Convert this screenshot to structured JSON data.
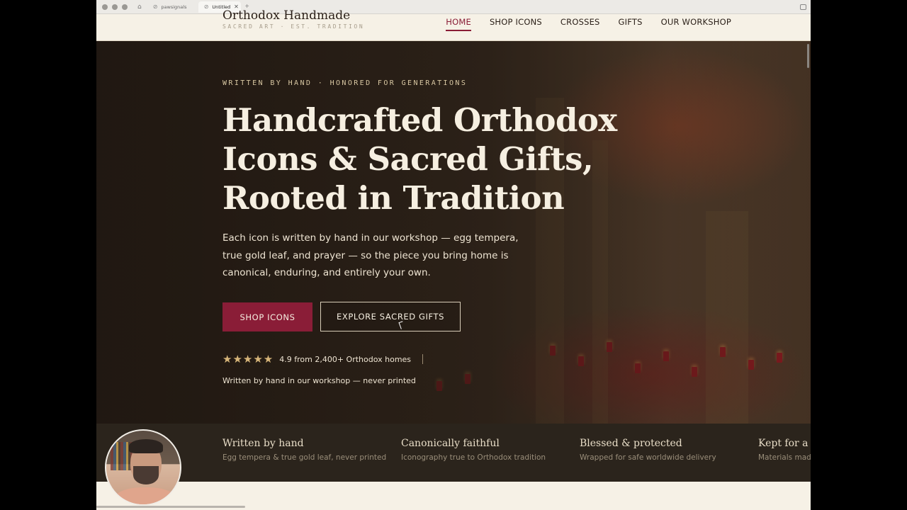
{
  "browser": {
    "tabs": [
      {
        "label": "pawsignals",
        "active": false
      },
      {
        "label": "Untitled",
        "active": true
      }
    ],
    "new_tab": "+"
  },
  "site": {
    "brand": "Orthodox Handmade",
    "tagline": "SACRED ART · EST. TRADITION",
    "nav": [
      {
        "label": "HOME",
        "active": true
      },
      {
        "label": "SHOP ICONS",
        "active": false
      },
      {
        "label": "CROSSES",
        "active": false
      },
      {
        "label": "GIFTS",
        "active": false
      },
      {
        "label": "OUR WORKSHOP",
        "active": false
      }
    ]
  },
  "hero": {
    "eyebrow": "WRITTEN BY HAND · HONORED FOR GENERATIONS",
    "title_lines": [
      "Handcrafted Orthodox",
      "Icons & Sacred Gifts,",
      "Rooted in Tradition"
    ],
    "body": "Each icon is written by hand in our workshop — egg tempera, true gold leaf, and prayer — so the piece you bring home is canonical, enduring, and entirely your own.",
    "primary_cta": "SHOP ICONS",
    "secondary_cta": "EXPLORE SACRED GIFTS",
    "stars": "★★★★★",
    "rating_value": 4.9,
    "rating_text": "4.9 from 2,400+ Orthodox homes",
    "note": "Written by hand in our workshop — never printed"
  },
  "features": [
    {
      "title": "Written by hand",
      "desc": "Egg tempera & true gold leaf, never printed"
    },
    {
      "title": "Canonically faithful",
      "desc": "Iconography true to Orthodox tradition"
    },
    {
      "title": "Blessed & protected",
      "desc": "Wrapped for safe worldwide delivery"
    },
    {
      "title": "Kept for a li",
      "desc": "Materials made"
    }
  ],
  "colors": {
    "accent": "#8a1d37",
    "header_bg": "#f6f1e6",
    "hero_dark": "#2c2219",
    "features_bg": "#2b241c",
    "star": "#d8b67a"
  }
}
